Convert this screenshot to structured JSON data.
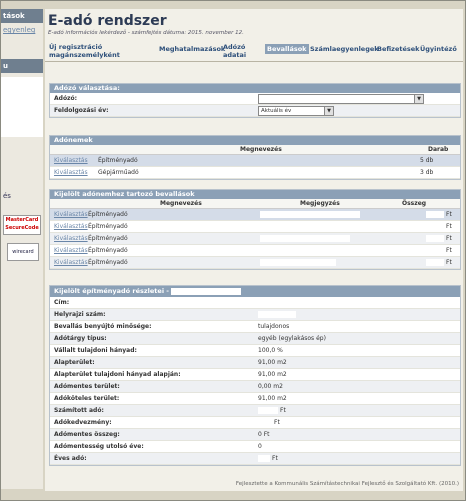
{
  "sidebar": {
    "header1": "tások",
    "link1": "egyenleg",
    "header2": "u",
    "text1": "és",
    "mastercard": "MasterCard SecureCode",
    "wirecard": "wirecard"
  },
  "header": {
    "title": "E-adó rendszer",
    "subtitle": "E-adó információs lekérdező - számfejtés dátuma: 2015. november 12."
  },
  "nav": {
    "items": [
      "Új regisztráció magánszemélyként",
      "Meghatalmazások",
      "Adózó adatai",
      "Bevallások",
      "Számlaegyenlegek",
      "Befizetések",
      "Ügyintéző"
    ],
    "active": "Bevallások"
  },
  "adozo_panel": {
    "title": "Adózó választása:",
    "adozo_label": "Adózó:",
    "ev_label": "Feldolgozási év:",
    "ev_value": "Aktuális év"
  },
  "adonemek": {
    "title": "Adónemek",
    "col_name": "Megnevezés",
    "col_count": "Darab",
    "rows": [
      {
        "action": "Kiválasztás",
        "name": "Építményadó",
        "count": "5 db"
      },
      {
        "action": "Kiválasztás",
        "name": "Gépjárműadó",
        "count": "3 db"
      }
    ]
  },
  "bevallasok": {
    "title": "Kijelölt adónemhez tartozó bevallások",
    "col_name": "Megnevezés",
    "col_note": "Megjegyzés",
    "col_sum": "Összeg",
    "rows": [
      {
        "action": "Kiválasztás",
        "name": "Építményadó",
        "currency": "Ft"
      },
      {
        "action": "Kiválasztás",
        "name": "Építményadó",
        "currency": "Ft"
      },
      {
        "action": "Kiválasztás",
        "name": "Építményadó",
        "currency": "Ft"
      },
      {
        "action": "Kiválasztás",
        "name": "Építményadó",
        "currency": "Ft"
      },
      {
        "action": "Kiválasztás",
        "name": "Építményadó",
        "currency": "Ft"
      }
    ]
  },
  "reszletek": {
    "title": "Kijelölt építményadó részletei -",
    "rows": [
      {
        "label": "Cím:",
        "value": ""
      },
      {
        "label": "Helyrajzi szám:",
        "value": ""
      },
      {
        "label": "Bevallás benyújtó minősége:",
        "value": "tulajdonos"
      },
      {
        "label": "Adótárgy típus:",
        "value": "egyéb (egylakásos ép)"
      },
      {
        "label": "Vállalt tulajdoni hányad:",
        "value": "100,0 %"
      },
      {
        "label": "Alapterület:",
        "value": "91,00 m2"
      },
      {
        "label": "Alapterület tulajdoni hányad alapján:",
        "value": "91,00 m2"
      },
      {
        "label": "Adómentes terület:",
        "value": "0,00 m2"
      },
      {
        "label": "Adóköteles terület:",
        "value": "91,00 m2"
      },
      {
        "label": "Számított adó:",
        "value": "Ft"
      },
      {
        "label": "Adókedvezmény:",
        "value": "Ft"
      },
      {
        "label": "Adómentes összeg:",
        "value": "0 Ft"
      },
      {
        "label": "Adómentesség utolsó éve:",
        "value": "0"
      },
      {
        "label": "Éves adó:",
        "value": "Ft"
      }
    ]
  },
  "footer": "Fejlesztette a Kommunális Számítástechnikai Fejlesztő és Szolgáltató Kft. (2010.)"
}
